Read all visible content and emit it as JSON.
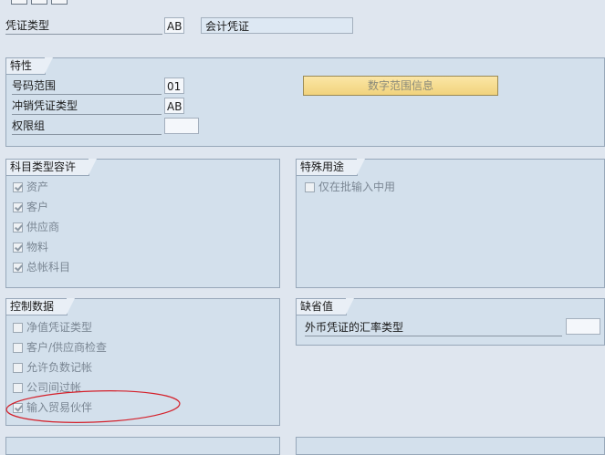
{
  "toolbar": {
    "buttons": [
      "",
      "",
      ""
    ]
  },
  "header": {
    "doc_type_label": "凭证类型",
    "doc_type_value": "AB",
    "doc_type_desc": "会计凭证"
  },
  "properties": {
    "title": "特性",
    "number_range_label": "号码范围",
    "number_range_value": "01",
    "reverse_type_label": "冲销凭证类型",
    "reverse_type_value": "AB",
    "auth_group_label": "权限组",
    "auth_group_value": "",
    "number_range_info_button": "数字范围信息"
  },
  "account_types": {
    "title": "科目类型容许",
    "items": [
      {
        "label": "资产",
        "checked": true
      },
      {
        "label": "客户",
        "checked": true
      },
      {
        "label": "供应商",
        "checked": true
      },
      {
        "label": "物料",
        "checked": true
      },
      {
        "label": "总帐科目",
        "checked": true
      }
    ]
  },
  "special_usage": {
    "title": "特殊用途",
    "items": [
      {
        "label": "仅在批输入中用",
        "checked": false
      }
    ]
  },
  "control_data": {
    "title": "控制数据",
    "items": [
      {
        "label": "净值凭证类型",
        "checked": false
      },
      {
        "label": "客户/供应商检查",
        "checked": false
      },
      {
        "label": "允许负数记帐",
        "checked": false
      },
      {
        "label": "公司间过帐",
        "checked": false
      },
      {
        "label": "输入贸易伙伴",
        "checked": true
      }
    ]
  },
  "defaults": {
    "title": "缺省值",
    "fx_rate_type_label": "外币凭证的汇率类型",
    "fx_rate_type_value": ""
  },
  "annotation": {
    "color": "#d4202a"
  }
}
